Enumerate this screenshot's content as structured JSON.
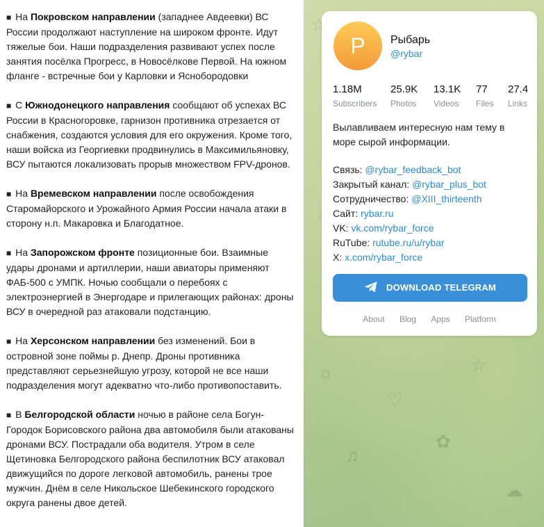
{
  "post": {
    "paragraphs": [
      {
        "bullet": "■",
        "pre": "На ",
        "bold": "Покровском направлении",
        "post": " (западнее Авдеевки) ВС России продолжают наступление на широком фронте. Идут тяжелые бои. Наши подразделения развивают успех после занятия посёлка Прогресс, в Новосёлковe Первой. На южном фланге - встречные бои у Карловки и Яснобородовки"
      },
      {
        "bullet": "■",
        "pre": "С ",
        "bold": "Южнодонецкого направления",
        "post": " сообщают об успехах ВС России в Красногоровке, гарнизон противника отрезается от снабжения, создаются условия для его окружения. Кроме того, наши войска из Георгиевки продвинулись в Максимильяновку, ВСУ пытаются локализовать прорыв множеством FPV-дронов."
      },
      {
        "bullet": "■",
        "pre": "На ",
        "bold": "Времевском направлении",
        "post": " после освобождения Старомайорского и Урожайного Армия России начала атаки в сторону н.п. Макаровка и Благодатное."
      },
      {
        "bullet": "■",
        "pre": "На ",
        "bold": "Запорожском фронте",
        "post": " позиционные бои. Взаимные удары дронами и артиллерии, наши авиаторы применяют ФАБ-500 с УМПК. Ночью сообщали о перебоях с электроэнергией в Энергодаре и прилегающих районах: дроны ВСУ в очередной раз атаковали подстанцию."
      },
      {
        "bullet": "■",
        "pre": "На ",
        "bold": "Херсонском направлении",
        "post": " без изменений. Бои в островной зоне поймы р. Днепр. Дроны противника представляют серьезнейшую угрозу, которой не все наши подразделения могут адекватно что-либо противопоставить."
      },
      {
        "bullet": "■",
        "pre": "В ",
        "bold": "Белгородской области",
        "post": " ночью в районе села Богун-Городок Борисовского района два автомобиля были атакованы дронами ВСУ. Пострадали оба водителя. Утром в селе Щетиновка Белгородского района беспилотник ВСУ атаковал движущийся по дороге легковой автомобиль, ранены трое мужчин. Днём в селе Никольское Шебекинского городского округа ранены двое детей."
      }
    ]
  },
  "channel": {
    "avatar_letter": "P",
    "name": "Рыбарь",
    "handle": "@rybar",
    "stats": [
      {
        "value": "1.18M",
        "label": "Subscribers"
      },
      {
        "value": "25.9K",
        "label": "Photos"
      },
      {
        "value": "13.1K",
        "label": "Videos"
      },
      {
        "value": "77",
        "label": "Files"
      },
      {
        "value": "27.4",
        "label": "Links"
      }
    ],
    "description": "Вылавливаем интересную нам тему в море сырой информации.",
    "links": [
      {
        "label": "Связь: ",
        "value": "@rybar_feedback_bot"
      },
      {
        "label": "Закрытый канал: ",
        "value": "@rybar_plus_bot"
      },
      {
        "label": "Сотрудничество: ",
        "value": "@XIII_thirteenth"
      },
      {
        "label": "Сайт: ",
        "value": "rybar.ru"
      },
      {
        "label": "VK: ",
        "value": "vk.com/rybar_force"
      },
      {
        "label": "RuTube: ",
        "value": "rutube.ru/u/rybar"
      },
      {
        "label": "X: ",
        "value": "x.com/rybar_force"
      }
    ],
    "download_button": "DOWNLOAD TELEGRAM",
    "footer": [
      "About",
      "Blog",
      "Apps",
      "Platform"
    ]
  },
  "colors": {
    "link": "#2b8cd6",
    "button": "#3a8fd9",
    "avatar_top": "#ffcc55",
    "avatar_bottom": "#f29a3a",
    "background_green": "#b7cd8f"
  }
}
